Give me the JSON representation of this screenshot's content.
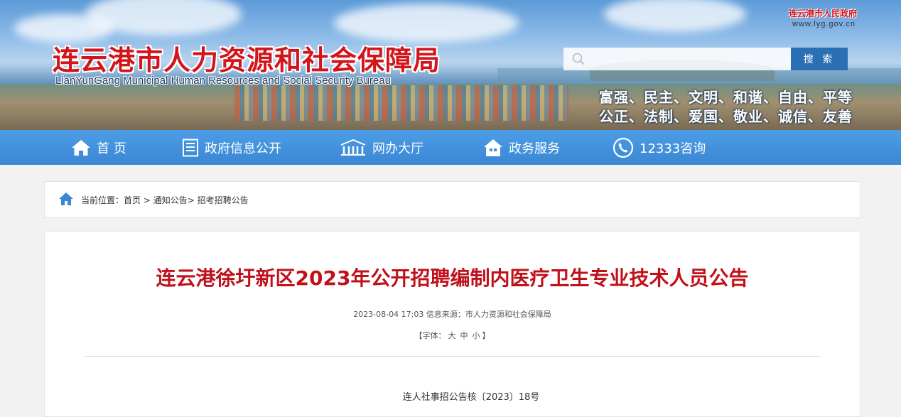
{
  "header": {
    "title_cn": "连云港市人力资源和社会保障局",
    "title_en": "LianYunGang Municipal Human Resources and Social Security Bureau",
    "gov_name": "连云港市人民政府",
    "gov_url": "www.lyg.gov.cn",
    "search": {
      "placeholder": "",
      "button_label": "搜 索"
    },
    "slogan_line1": "富强、民主、文明、和谐、自由、平等",
    "slogan_line2": "公正、法制、爱国、敬业、诚信、友善"
  },
  "nav": {
    "items": [
      {
        "label": "首 页",
        "icon": "home-icon"
      },
      {
        "label": "政府信息公开",
        "icon": "document-icon"
      },
      {
        "label": "网办大厅",
        "icon": "building-icon"
      },
      {
        "label": "政务服务",
        "icon": "house-icon"
      },
      {
        "label": "12333咨询",
        "icon": "phone-icon"
      }
    ]
  },
  "breadcrumb": {
    "prefix": "当前位置：",
    "items": [
      "首页",
      "通知公告",
      "招考招聘公告"
    ],
    "sep1": " > ",
    "sep2": "> "
  },
  "article": {
    "title": "连云港徐圩新区2023年公开招聘编制内医疗卫生专业技术人员公告",
    "date": "2023-08-04 17:03",
    "source_label": "信息来源：",
    "source": "市人力资源和社会保障局",
    "font_label": "【字体：",
    "font_sizes": [
      "大",
      "中",
      "小"
    ],
    "font_close": "】",
    "doc_number": "连人社事招公告核〔2023〕18号"
  },
  "colors": {
    "nav_bg": "#3f8fdb",
    "title_red": "#c0111a",
    "search_button": "#2b6fb4"
  }
}
